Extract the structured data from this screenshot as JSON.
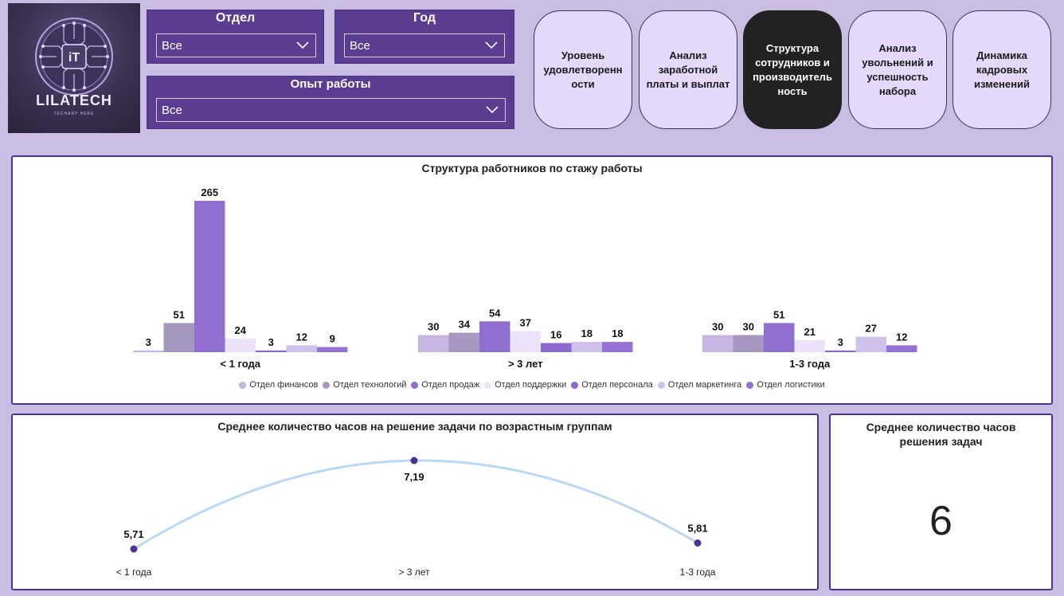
{
  "logo": {
    "name": "LILATECH",
    "tagline": "TECHARY HERE",
    "emblem_label": "iT"
  },
  "filters": {
    "department": {
      "title": "Отдел",
      "value": "Все"
    },
    "year": {
      "title": "Год",
      "value": "Все"
    },
    "experience": {
      "title": "Опыт работы",
      "value": "Все"
    }
  },
  "nav": [
    {
      "label": "Уровень удовлетворенн ости",
      "active": false
    },
    {
      "label": "Анализ заработной платы и выплат",
      "active": false
    },
    {
      "label": "Структура сотрудников и производитель ность",
      "active": true
    },
    {
      "label": "Анализ увольнений и успешность набора",
      "active": false
    },
    {
      "label": "Динамика кадровых изменений",
      "active": false
    }
  ],
  "colors": {
    "accent": "#5a3d91",
    "background": "#c9bde4",
    "line": "#b9d8f5",
    "point": "#4b3391"
  },
  "bar_card": {
    "title": "Структура работников по стажу работы"
  },
  "line_card": {
    "title": "Среднее количество часов на решение задачи по возрастным группам"
  },
  "kpi": {
    "title": "Среднее количество часов решения задач",
    "value": "6"
  },
  "chart_data": [
    {
      "type": "bar",
      "title": "Структура работников по стажу работы",
      "categories": [
        "< 1 года",
        "> 3 лет",
        "1-3 года"
      ],
      "series": [
        {
          "name": "Отдел финансов",
          "color": "#c4b5e3",
          "values": [
            3,
            30,
            30
          ]
        },
        {
          "name": "Отдел технологий",
          "color": "#a598c0",
          "values": [
            51,
            34,
            30
          ]
        },
        {
          "name": "Отдел продаж",
          "color": "#8f6ed0",
          "values": [
            265,
            54,
            51
          ]
        },
        {
          "name": "Отдел поддержки",
          "color": "#ece3fb",
          "values": [
            24,
            37,
            21
          ]
        },
        {
          "name": "Отдел персонала",
          "color": "#8c67cc",
          "values": [
            3,
            16,
            3
          ]
        },
        {
          "name": "Отдел маркетинга",
          "color": "#cec1ea",
          "values": [
            12,
            18,
            27
          ]
        },
        {
          "name": "Отдел логистики",
          "color": "#9573d4",
          "values": [
            9,
            18,
            12
          ]
        }
      ],
      "legend": "bottom",
      "grid": false
    },
    {
      "type": "line",
      "title": "Среднее количество часов на решение задачи по возрастным группам",
      "categories": [
        "< 1 года",
        "> 3 лет",
        "1-3 года"
      ],
      "values": [
        5.71,
        7.19,
        5.81
      ],
      "labels": [
        "5,71",
        "7,19",
        "5,81"
      ],
      "grid": false
    }
  ]
}
